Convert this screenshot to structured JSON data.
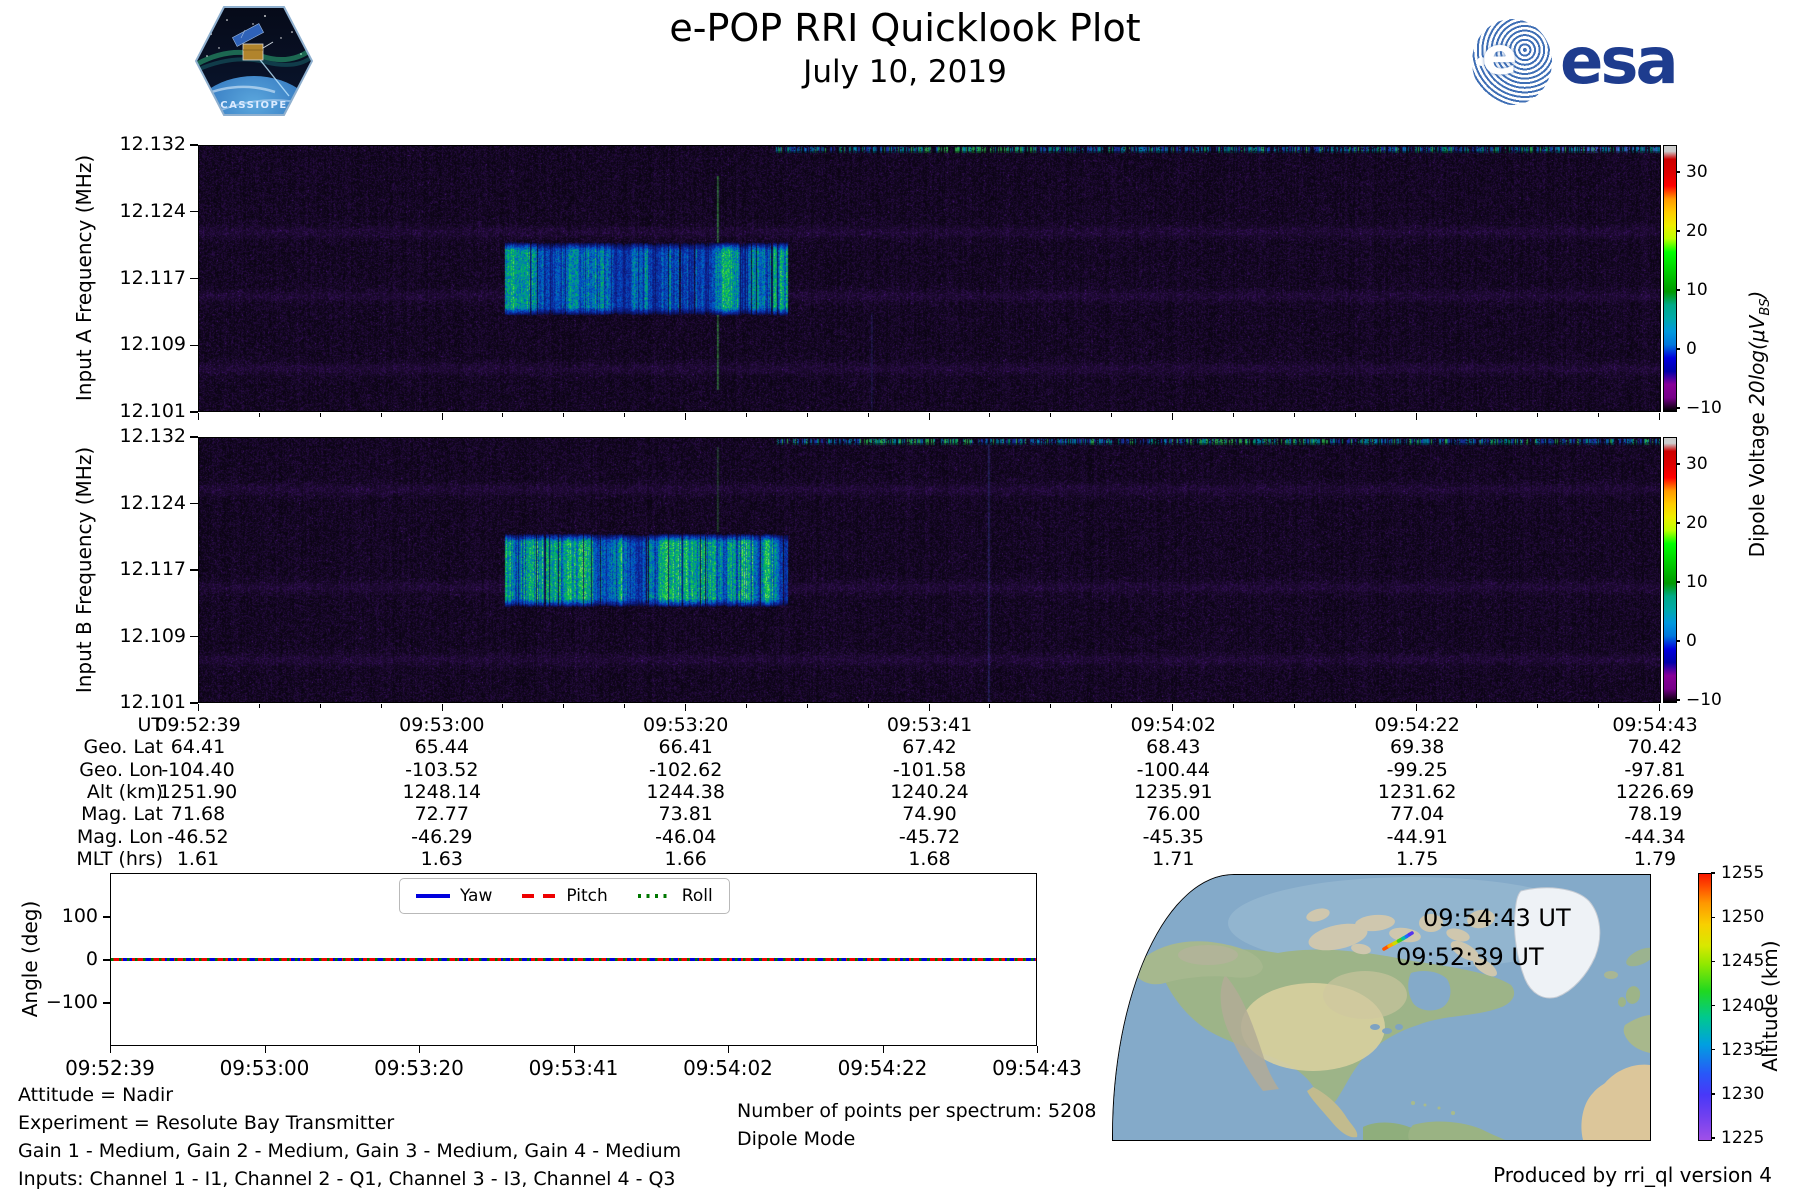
{
  "header": {
    "title": "e-POP RRI Quicklook Plot",
    "date": "July 10, 2019",
    "mission_patch_text": "CASSIOPE",
    "esa_wordmark": "esa",
    "esa_blue": "#1e3c8e"
  },
  "spectrograms": {
    "colorbar_label_prefix": "Dipole Voltage ",
    "colorbar_label_math": "20log(μV",
    "colorbar_label_sub": "BS",
    "colorbar_label_close": ")",
    "colorbar_ticks": [
      "30",
      "20",
      "10",
      "0",
      "−10"
    ],
    "panels": [
      {
        "ylabel": "Input A Frequency (MHz)",
        "yticks": [
          "12.132",
          "12.124",
          "12.117",
          "12.109",
          "12.101"
        ]
      },
      {
        "ylabel": "Input B Frequency (MHz)",
        "yticks": [
          "12.132",
          "12.124",
          "12.117",
          "12.109",
          "12.101"
        ]
      }
    ]
  },
  "ephemeris": {
    "rows": [
      {
        "label": "UT",
        "values": [
          "09:52:39",
          "09:53:00",
          "09:53:20",
          "09:53:41",
          "09:54:02",
          "09:54:22",
          "09:54:43"
        ]
      },
      {
        "label": "Geo. Lat",
        "values": [
          "64.41",
          "65.44",
          "66.41",
          "67.42",
          "68.43",
          "69.38",
          "70.42"
        ]
      },
      {
        "label": "Geo. Lon",
        "values": [
          "-104.40",
          "-103.52",
          "-102.62",
          "-101.58",
          "-100.44",
          "-99.25",
          "-97.81"
        ]
      },
      {
        "label": "Alt (km)",
        "values": [
          "1251.90",
          "1248.14",
          "1244.38",
          "1240.24",
          "1235.91",
          "1231.62",
          "1226.69"
        ]
      },
      {
        "label": "Mag. Lat",
        "values": [
          "71.68",
          "72.77",
          "73.81",
          "74.90",
          "76.00",
          "77.04",
          "78.19"
        ]
      },
      {
        "label": "Mag. Lon",
        "values": [
          "-46.52",
          "-46.29",
          "-46.04",
          "-45.72",
          "-45.35",
          "-44.91",
          "-44.34"
        ]
      },
      {
        "label": "MLT (hrs)",
        "values": [
          "1.61",
          "1.63",
          "1.66",
          "1.68",
          "1.71",
          "1.75",
          "1.79"
        ]
      }
    ]
  },
  "angle_plot": {
    "ylabel": "Angle (deg)",
    "yticks": [
      "100",
      "0",
      "−100"
    ],
    "xticks": [
      "09:52:39",
      "09:53:00",
      "09:53:20",
      "09:53:41",
      "09:54:02",
      "09:54:22",
      "09:54:43"
    ],
    "legend": [
      {
        "label": "Yaw",
        "color": "#0000dd",
        "style": "solid"
      },
      {
        "label": "Pitch",
        "color": "#ee0000",
        "style": "dashed"
      },
      {
        "label": "Roll",
        "color": "#007700",
        "style": "dotted"
      }
    ]
  },
  "map": {
    "annotations": [
      "09:54:43 UT",
      "09:52:39 UT"
    ],
    "colorbar_label": "Altitude (km)",
    "colorbar_ticks": [
      "1255",
      "1250",
      "1245",
      "1240",
      "1235",
      "1230",
      "1225"
    ]
  },
  "footer": {
    "attitude": "Attitude = Nadir",
    "experiment": "Experiment = Resolute Bay Transmitter",
    "gains": "Gain 1 - Medium, Gain 2 - Medium, Gain 3 - Medium, Gain 4 - Medium",
    "inputs": "Inputs: Channel 1 - I1, Channel 2 - Q1, Channel 3 - I3, Channel 4 - Q3",
    "points_per_spectrum": "Number of points per spectrum: 5208",
    "mode": "Dipole Mode",
    "produced_by": "Produced by rri_ql version 4"
  },
  "chart_data": [
    {
      "type": "heatmap",
      "title": "Input A spectrogram",
      "ylabel": "Input A Frequency (MHz)",
      "xlabel": "UT",
      "x_range": [
        "09:52:39",
        "09:54:43"
      ],
      "x_span_seconds": 124,
      "ylim_mhz": [
        12.101,
        12.132
      ],
      "yticks_mhz": [
        12.132,
        12.124,
        12.117,
        12.109,
        12.101
      ],
      "colormap": "nipy_spectral",
      "colorbar": {
        "label": "Dipole Voltage 20log(uV_BS)",
        "ticks": [
          30,
          20,
          10,
          0,
          -10
        ],
        "range": [
          -10.7,
          34.5
        ]
      },
      "background_level_db": -10,
      "render": {
        "seed": 11,
        "burst_gain": 1.0
      },
      "features": [
        {
          "name": "transmitter-pulse-train",
          "start": "09:53:05",
          "end": "09:53:29",
          "freq_mhz": [
            12.1125,
            12.1205
          ],
          "intensity_db": "10-20"
        },
        {
          "name": "top-edge-interference-band",
          "start": "09:53:28",
          "end": "09:54:43",
          "freq_mhz": [
            12.1313,
            12.132
          ],
          "intensity_db": "0-15",
          "clusters": [
            {
              "start": "09:53:40",
              "end": "09:53:50",
              "type": "green"
            },
            {
              "start": "09:54:34",
              "end": "09:54:43",
              "type": "blue-bright"
            }
          ]
        },
        {
          "name": "narrowband-tone",
          "time": "09:53:23",
          "freq_mhz": [
            12.1035,
            12.1285
          ],
          "rgb": [
            70,
            215,
            75
          ],
          "alpha": 0.6,
          "intensity_db": "~12"
        },
        {
          "name": "narrowband-tone",
          "time": "09:53:36",
          "freq_mhz": [
            12.101,
            12.1125
          ],
          "rgb": [
            50,
            90,
            210
          ],
          "alpha": 0.22,
          "intensity_db": "~0"
        },
        {
          "name": "noise-floor-lines",
          "freqs_mhz": [
            12.122,
            12.1145,
            12.106
          ]
        }
      ]
    },
    {
      "type": "heatmap",
      "title": "Input B spectrogram",
      "ylabel": "Input B Frequency (MHz)",
      "xlabel": "UT",
      "x_range": [
        "09:52:39",
        "09:54:43"
      ],
      "x_span_seconds": 124,
      "ylim_mhz": [
        12.101,
        12.132
      ],
      "yticks_mhz": [
        12.132,
        12.124,
        12.117,
        12.109,
        12.101
      ],
      "colormap": "nipy_spectral",
      "colorbar": {
        "label": "Dipole Voltage 20log(uV_BS)",
        "ticks": [
          30,
          20,
          10,
          0,
          -10
        ],
        "range": [
          -10.7,
          34.5
        ]
      },
      "background_level_db": -10,
      "render": {
        "seed": 29,
        "burst_gain": 1.12
      },
      "features": [
        {
          "name": "transmitter-pulse-train",
          "start": "09:53:05",
          "end": "09:53:29",
          "freq_mhz": [
            12.1125,
            12.1205
          ],
          "intensity_db": "12-22"
        },
        {
          "name": "top-edge-interference-band",
          "start": "09:53:28",
          "end": "09:54:43",
          "freq_mhz": [
            12.1313,
            12.132
          ],
          "intensity_db": "0-18",
          "clusters": [
            {
              "start": "09:53:35",
              "end": "09:53:45",
              "type": "green"
            },
            {
              "start": "09:54:05",
              "end": "09:54:15",
              "type": "green"
            }
          ]
        },
        {
          "name": "narrowband-tone",
          "time": "09:53:23",
          "freq_mhz": [
            12.121,
            12.131
          ],
          "rgb": [
            70,
            215,
            75
          ],
          "alpha": 0.35,
          "intensity_db": "~8"
        },
        {
          "name": "narrowband-tone",
          "time": "09:53:46",
          "freq_mhz": [
            12.101,
            12.1313
          ],
          "rgb": [
            60,
            110,
            225
          ],
          "alpha": 0.3,
          "intensity_db": "~2"
        },
        {
          "name": "noise-floor-lines",
          "freqs_mhz": [
            12.126,
            12.1145,
            12.106
          ]
        }
      ]
    },
    {
      "type": "line",
      "title": "Spacecraft attitude angles",
      "ylabel": "Angle (deg)",
      "ylim": [
        -200,
        200
      ],
      "yticks": [
        100,
        0,
        -100
      ],
      "x": [
        "09:52:39",
        "09:53:00",
        "09:53:20",
        "09:53:41",
        "09:54:02",
        "09:54:22",
        "09:54:43"
      ],
      "series": [
        {
          "name": "Yaw",
          "color": "#0000dd",
          "style": "solid",
          "values": [
            0,
            0,
            0,
            0,
            0,
            0,
            0
          ]
        },
        {
          "name": "Pitch",
          "color": "#ee0000",
          "style": "dashed",
          "values": [
            0,
            0,
            0,
            0,
            0,
            0,
            0
          ]
        },
        {
          "name": "Roll",
          "color": "#007700",
          "style": "dotted",
          "values": [
            0,
            0,
            0,
            0,
            0,
            0,
            0
          ]
        }
      ],
      "legend_position": "upper center",
      "grid": false
    },
    {
      "type": "map-track",
      "title": "Ground track over northern Canada",
      "track": {
        "start": {
          "label": "09:52:39 UT",
          "alt_km": 1251.9
        },
        "end": {
          "label": "09:54:43 UT",
          "alt_km": 1226.69
        }
      },
      "colorbar": {
        "label": "Altitude (km)",
        "ticks": [
          1255,
          1250,
          1245,
          1240,
          1235,
          1230,
          1225
        ],
        "colormap": "rainbow"
      }
    }
  ]
}
